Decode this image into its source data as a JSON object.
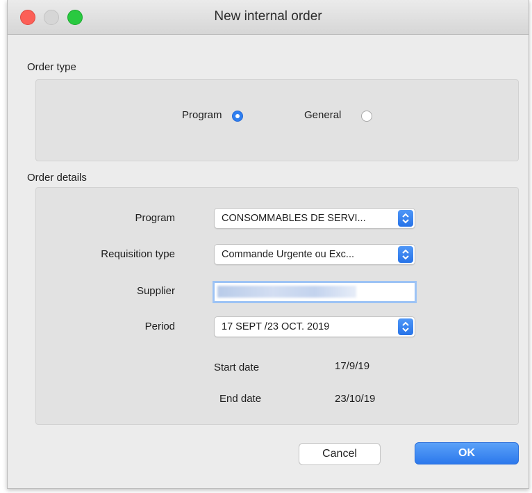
{
  "window": {
    "title": "New internal order"
  },
  "order_type": {
    "label": "Order type",
    "options": [
      {
        "label": "Program",
        "selected": true
      },
      {
        "label": "General",
        "selected": false
      }
    ]
  },
  "order_details": {
    "label": "Order details",
    "program": {
      "label": "Program",
      "value": "CONSOMMABLES DE SERVI..."
    },
    "requisition_type": {
      "label": "Requisition type",
      "value": "Commande Urgente ou Exc..."
    },
    "supplier": {
      "label": "Supplier",
      "value": ""
    },
    "period": {
      "label": "Period",
      "value": "17 SEPT /23 OCT. 2019"
    },
    "start_date": {
      "label": "Start date",
      "value": "17/9/19"
    },
    "end_date": {
      "label": "End date",
      "value": "23/10/19"
    }
  },
  "buttons": {
    "cancel": "Cancel",
    "ok": "OK"
  },
  "colors": {
    "accent": "#2f7ff0",
    "close": "#fc5f57",
    "maximize": "#29c940"
  },
  "icons": {
    "dropdown": "updown-chevron-icon"
  }
}
